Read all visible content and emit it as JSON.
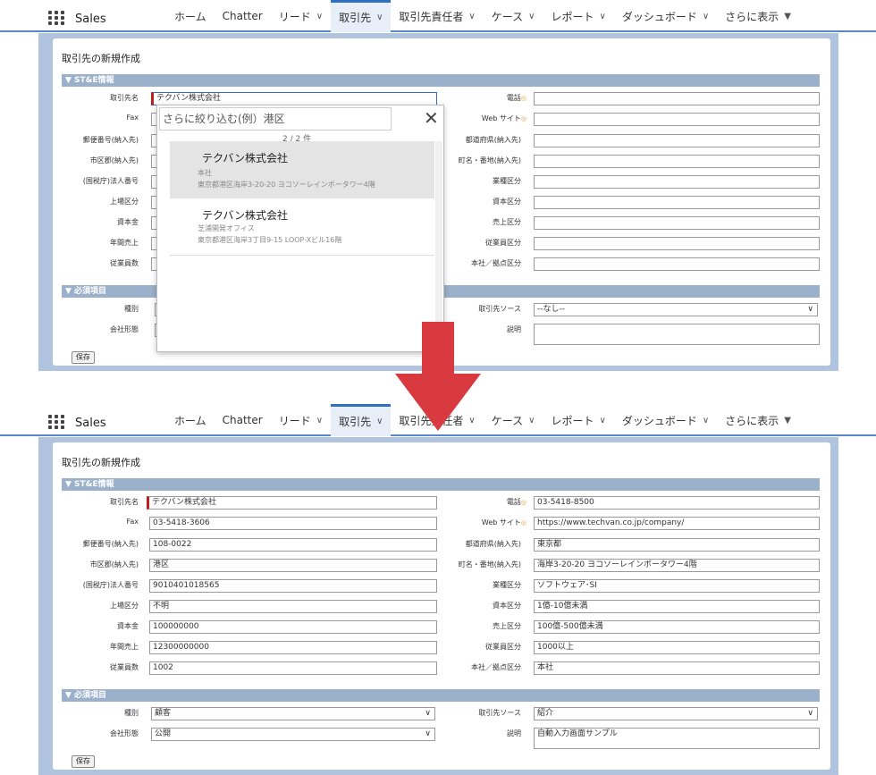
{
  "nav": {
    "app_name": "Sales",
    "tabs": [
      {
        "label": "ホーム",
        "dropdown": false
      },
      {
        "label": "Chatter",
        "dropdown": false
      },
      {
        "label": "リード",
        "dropdown": true
      },
      {
        "label": "取引先",
        "dropdown": true
      },
      {
        "label": "取引先責任者",
        "dropdown": true
      },
      {
        "label": "ケース",
        "dropdown": true
      },
      {
        "label": "レポート",
        "dropdown": true
      },
      {
        "label": "ダッシュボード",
        "dropdown": true
      },
      {
        "label": "さらに表示",
        "dropdown": true
      }
    ],
    "active_tab": "取引先",
    "chevron": "∨",
    "more_chevron": "▼"
  },
  "form": {
    "title": "取引先の新規作成",
    "section1": "▼ ST&E情報",
    "section2": "▼ 必須項目",
    "save_label": "保存",
    "left_labels": [
      "取引先名",
      "Fax",
      "郵便番号(納入先)",
      "市区郡(納入先)",
      "(国税庁)法人番号",
      "上場区分",
      "資本金",
      "年間売上",
      "従業員数"
    ],
    "right_labels": [
      "電話",
      "Web サイト",
      "都道府県(納入先)",
      "町名・番地(納入先)",
      "業種区分",
      "資本区分",
      "売上区分",
      "従業員区分",
      "本社／拠点区分"
    ],
    "req_left_labels": [
      "種別",
      "会社形態"
    ],
    "req_right_labels": [
      "取引先ソース",
      "説明"
    ]
  },
  "before": {
    "account_name": "テクバン株式会社",
    "source_value": "--なし--",
    "lookup": {
      "search_placeholder": "さらに絞り込む(例）港区",
      "count": "2 / 2 件",
      "results": [
        {
          "name": "テクバン株式会社",
          "line1": "本社",
          "line2": "東京都港区海岸3-20-20 ヨコソーレインボータワー4階"
        },
        {
          "name": "テクバン株式会社",
          "line1": "芝浦開発オフィス",
          "line2": "東京都港区海岸3丁目9-15 LOOP-Xビル16階"
        }
      ]
    }
  },
  "after": {
    "left_values": [
      "テクバン株式会社",
      "03-5418-3606",
      "108-0022",
      "港区",
      "9010401018565",
      "不明",
      "100000000",
      "12300000000",
      "1002"
    ],
    "right_values": [
      "03-5418-8500",
      "https://www.techvan.co.jp/company/",
      "東京都",
      "海岸3-20-20 ヨコソーレインボータワー4階",
      "ソフトウェア･SI",
      "1億-10億未満",
      "100億-500億未満",
      "1000以上",
      "本社"
    ],
    "type_value": "顧客",
    "company_form_value": "公開",
    "source_value": "紹介",
    "description_value": "自動入力画面サンプル"
  },
  "colors": {
    "arrow": "#d93a3f",
    "section_bar": "#9bb0cb",
    "background": "#b0c4df",
    "required": "#c01e1e"
  }
}
